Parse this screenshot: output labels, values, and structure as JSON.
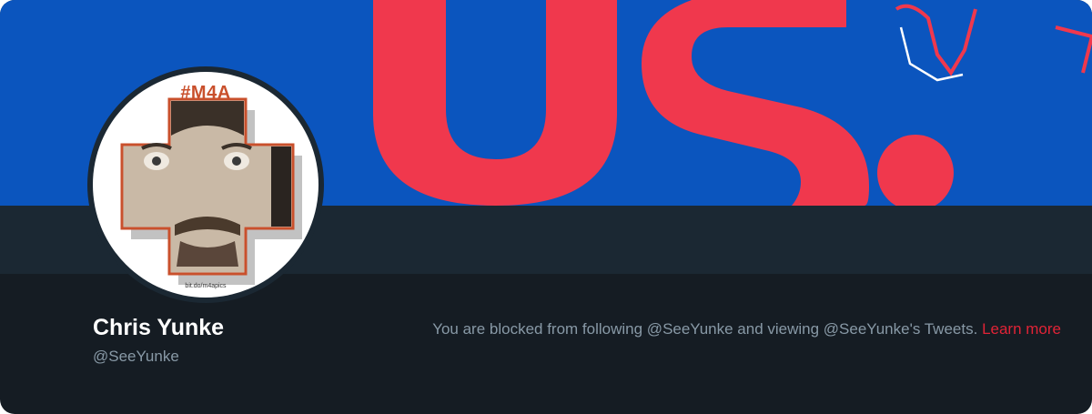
{
  "profile": {
    "display_name": "Chris Yunke",
    "handle": "@SeeYunke",
    "avatar": {
      "tag": "#M4A",
      "url_text": "bit.do/m4apics"
    }
  },
  "banner": {
    "text": "US.",
    "background_color": "#0b55be",
    "text_color": "#f0384d"
  },
  "blocked_notice": {
    "message": "You are blocked from following @SeeYunke and viewing @SeeYunke's Tweets.",
    "link_label": "Learn more"
  },
  "colors": {
    "card_background": "#151c23",
    "strip_background": "#1b2833",
    "secondary_text": "#8899a6",
    "link": "#e02336"
  }
}
